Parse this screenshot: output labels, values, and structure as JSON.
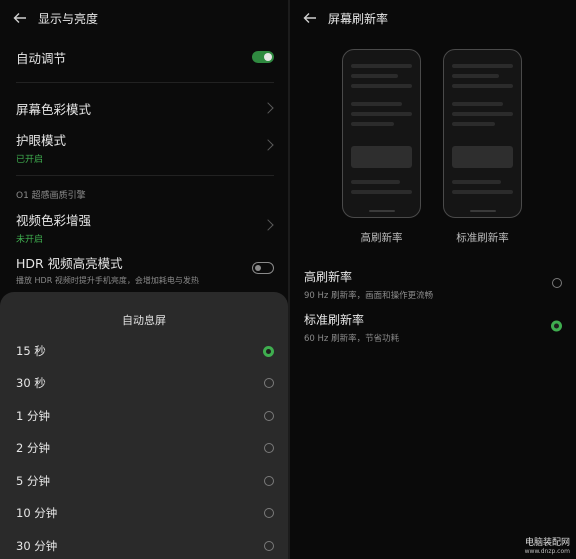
{
  "left": {
    "header": {
      "title": "显示与亮度"
    },
    "auto_adjust": {
      "label": "自动调节",
      "toggle": "on"
    },
    "color_mode": {
      "label": "屏幕色彩模式"
    },
    "eye_care": {
      "label": "护眼模式",
      "status": "已开启"
    },
    "section_title": "O1 超感画质引擎",
    "video_enhance": {
      "label": "视频色彩增强",
      "status": "未开启"
    },
    "hdr": {
      "label": "HDR 视频高亮模式",
      "desc": "播放 HDR 视频时提升手机亮度，会增加耗电与发热",
      "toggle": "off"
    },
    "sheet": {
      "title": "自动息屏",
      "options": [
        "15 秒",
        "30 秒",
        "1 分钟",
        "2 分钟",
        "5 分钟",
        "10 分钟",
        "30 分钟"
      ],
      "selected": "15 秒"
    }
  },
  "right": {
    "header": {
      "title": "屏幕刷新率"
    },
    "preview_labels": [
      "高刷新率",
      "标准刷新率"
    ],
    "options": [
      {
        "label": "高刷新率",
        "desc": "90 Hz 刷新率，画面和操作更流畅",
        "selected": false
      },
      {
        "label": "标准刷新率",
        "desc": "60 Hz 刷新率，节省功耗",
        "selected": true
      }
    ]
  },
  "watermark": {
    "line1": "电脑装配网",
    "line2": "www.dnzp.com"
  },
  "colors": {
    "accent": "#3fae4f",
    "background": "#0b0b0b",
    "sheet": "#2a2a2a"
  }
}
